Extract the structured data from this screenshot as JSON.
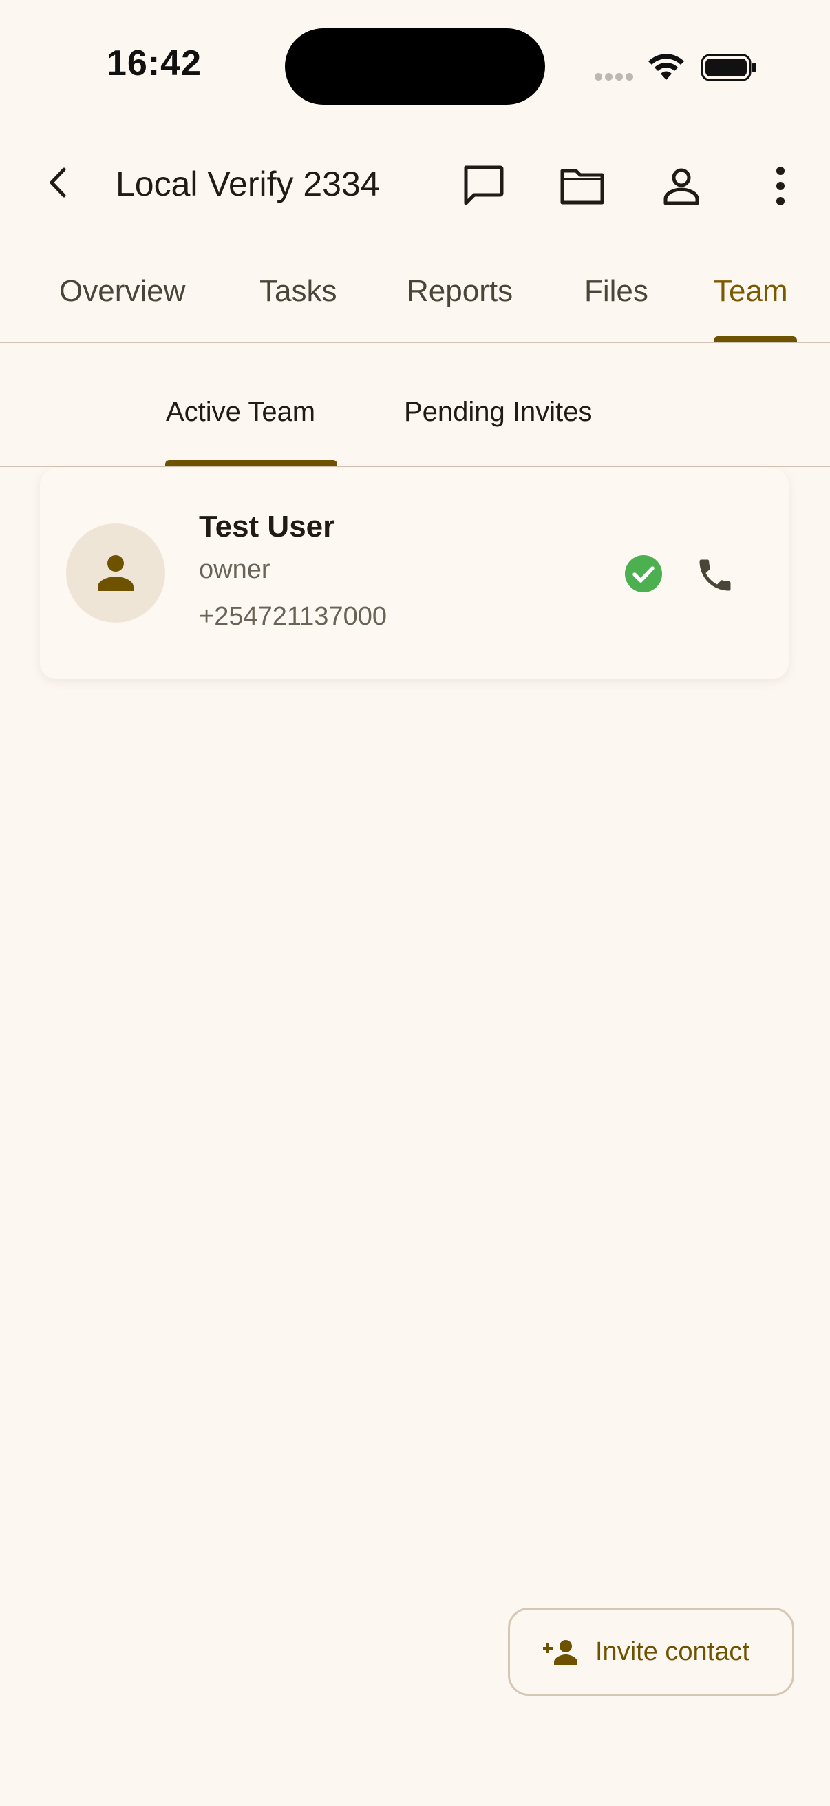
{
  "status_bar": {
    "time": "16:42"
  },
  "app_bar": {
    "title": "Local Verify 2334",
    "back_icon": "chevron-left-icon",
    "actions": [
      "chat-icon",
      "folder-icon",
      "person-icon",
      "more-vert-icon"
    ]
  },
  "main_tabs": {
    "items": [
      {
        "label": "Overview",
        "active": false
      },
      {
        "label": "Tasks",
        "active": false
      },
      {
        "label": "Reports",
        "active": false
      },
      {
        "label": "Files",
        "active": false
      },
      {
        "label": "Team",
        "active": true
      }
    ]
  },
  "sub_tabs": {
    "items": [
      {
        "label": "Active Team",
        "active": true
      },
      {
        "label": "Pending Invites",
        "active": false
      }
    ]
  },
  "team": {
    "members": [
      {
        "name": "Test User",
        "role": "owner",
        "phone": "+254721137000",
        "verified": true
      }
    ]
  },
  "invite": {
    "label": "Invite contact",
    "icon": "person-add-icon"
  },
  "colors": {
    "background": "#FDF7F1",
    "accent": "#6F5200",
    "verified": "#4CAF50"
  }
}
